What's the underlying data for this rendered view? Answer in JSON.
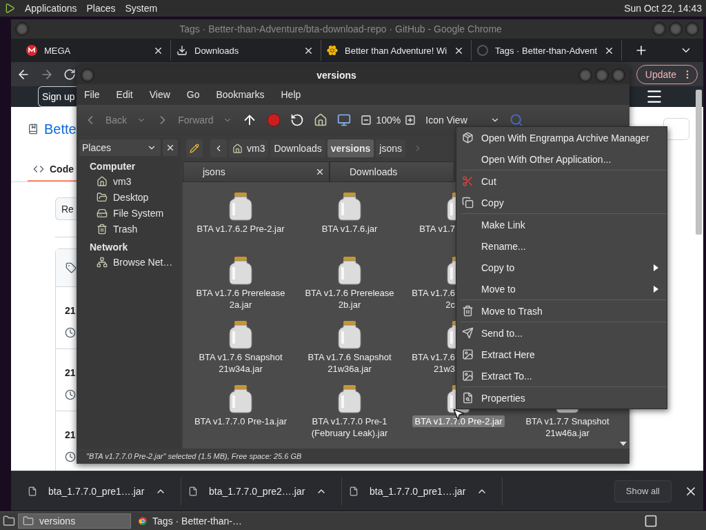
{
  "top_panel": {
    "menus": [
      "Applications",
      "Places",
      "System"
    ],
    "clock": "Sun Oct 22, 14:43"
  },
  "browser": {
    "title": "Tags · Better-than-Adventure/bta-download-repo · GitHub - Google Chrome",
    "tabs": [
      {
        "label": "MEGA"
      },
      {
        "label": "Downloads"
      },
      {
        "label": "Better than Adventure! Wi"
      },
      {
        "label": "Tags · Better-than-Advent"
      }
    ],
    "update_button": "Update",
    "page": {
      "sign_up": "Sign up",
      "repo_link": "Bette",
      "code_tab": "Code",
      "button": "Re",
      "tag_rows": [
        "21",
        "21",
        "21"
      ]
    },
    "downloads": [
      "bta_1.7.7.0_pre1….jar",
      "bta_1.7.7.0_pre2….jar",
      "bta_1.7.7.0_pre1….jar"
    ],
    "show_all": "Show all"
  },
  "file_manager": {
    "title": "versions",
    "menus": [
      "File",
      "Edit",
      "View",
      "Go",
      "Bookmarks",
      "Help"
    ],
    "toolbar": {
      "back": {
        "label": "Back",
        "disabled": true
      },
      "forward": {
        "label": "Forward",
        "disabled": true
      },
      "zoom": "100%",
      "view": "Icon View"
    },
    "sidebar": {
      "header": "Places",
      "sections": [
        {
          "label": "Computer",
          "children": [
            {
              "label": "vm3"
            },
            {
              "label": "Desktop"
            },
            {
              "label": "File System"
            },
            {
              "label": "Trash"
            }
          ]
        },
        {
          "label": "Network",
          "children": [
            {
              "label": "Browse Net…"
            }
          ]
        }
      ]
    },
    "path": [
      {
        "label": "vm3",
        "selected": false
      },
      {
        "label": "Downloads",
        "selected": false
      },
      {
        "label": "versions",
        "selected": true
      },
      {
        "label": "jsons",
        "selected": false
      }
    ],
    "tabs": [
      {
        "label": "jsons",
        "close": true
      },
      {
        "label": "Downloads",
        "close": false
      }
    ],
    "rows": [
      [
        {
          "name": "BTA v1.7.6.2 Pre-2.jar",
          "selected": false,
          "covered": false
        },
        {
          "name": "BTA v1.7.6.jar",
          "selected": false,
          "covered": false
        },
        {
          "name": "BTA v1.7",
          "selected": false,
          "covered": true
        }
      ],
      [
        {
          "name": "BTA v1.7.6 Prerelease 2a.jar",
          "selected": false,
          "covered": false
        },
        {
          "name": "BTA v1.7.6 Prerelease 2b.jar",
          "selected": false,
          "covered": false
        },
        {
          "name": "BTA v1.7.6 2c",
          "selected": false,
          "covered": true
        }
      ],
      [
        {
          "name": "BTA v1.7.6 Snapshot 21w34a.jar",
          "selected": false,
          "covered": false
        },
        {
          "name": "BTA v1.7.6 Snapshot 21w36a.jar",
          "selected": false,
          "covered": false
        },
        {
          "name": "BTA v1.7.6 21w3",
          "selected": false,
          "covered": true
        }
      ],
      [
        {
          "name": "BTA v1.7.7.0 Pre-1a.jar",
          "selected": false,
          "covered": false
        },
        {
          "name": "BTA v1.7.7.0 Pre-1 (February Leak).jar",
          "selected": false,
          "covered": false
        },
        {
          "name": "BTA v1.7.7.0 Pre-2.jar",
          "selected": true,
          "covered": false
        },
        {
          "name": "BTA v1.7.7 Snapshot 21w46a.jar",
          "selected": false,
          "covered": false
        }
      ]
    ],
    "status": "\"BTA v1.7.7.0 Pre-2.jar\" selected (1.5 MB), Free space: 25.6 GB"
  },
  "context_menu": {
    "groups": [
      [
        {
          "label": "Open With Engrampa Archive Manager",
          "submenu": false
        },
        {
          "label": "Open With Other Application...",
          "submenu": false
        }
      ],
      [
        {
          "label": "Cut",
          "submenu": false
        },
        {
          "label": "Copy",
          "submenu": false
        }
      ],
      [
        {
          "label": "Make Link",
          "submenu": false
        },
        {
          "label": "Rename...",
          "submenu": false
        },
        {
          "label": "Copy to",
          "submenu": true
        },
        {
          "label": "Move to",
          "submenu": true
        }
      ],
      [
        {
          "label": "Move to Trash",
          "submenu": false
        }
      ],
      [
        {
          "label": "Send to...",
          "submenu": false
        },
        {
          "label": "Extract Here",
          "submenu": false
        },
        {
          "label": "Extract To...",
          "submenu": false
        }
      ],
      [
        {
          "label": "Properties",
          "submenu": false
        }
      ]
    ]
  },
  "taskbar": {
    "items": [
      {
        "label": "versions",
        "selected": true
      },
      {
        "label": "Tags · Better-than-…",
        "selected": false
      }
    ]
  }
}
